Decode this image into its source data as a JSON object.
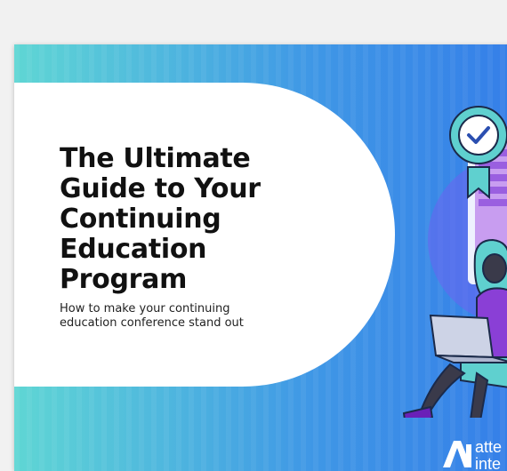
{
  "cover": {
    "title_lines": [
      "The Ultimate",
      "Guide to Your",
      "Continuing",
      "Education",
      "Program"
    ],
    "subtitle_lines": [
      "How to make your continuing",
      "education conference stand out"
    ]
  },
  "logo": {
    "word1": "atte",
    "word2": "inte",
    "icon": "ai-logo-icon"
  },
  "illustration": {
    "icons": [
      "certificate-badge-icon",
      "checkmark-icon",
      "woman-with-laptop-illustration"
    ]
  },
  "colors": {
    "gradient_start": "#5fd6d4",
    "gradient_end": "#357fe8",
    "badge": "#5fd0cf",
    "check": "#2b4fb0",
    "purple": "#8a3fd6",
    "boots": "#6a1fb8"
  }
}
